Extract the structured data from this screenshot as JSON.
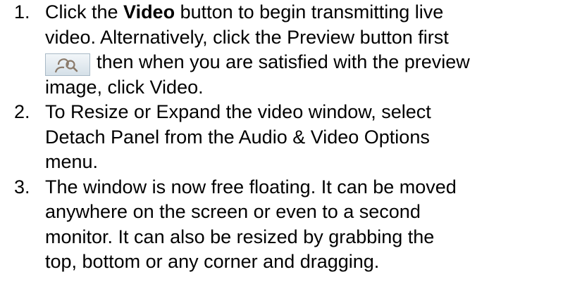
{
  "steps": [
    {
      "number": "1.",
      "line1_prefix": "Click the ",
      "line1_bold": "Video",
      "line1_suffix": " button to begin transmitting live",
      "line2": "video. Alternatively, click the Preview button first",
      "line3_after_icon": "then when you are satisfied with the preview",
      "line4": "image, click Video.",
      "icon": "preview-person-magnifier-icon"
    },
    {
      "number": "2.",
      "lines": [
        "To Resize or Expand the video window, select",
        "Detach Panel from the Audio & Video Options",
        "menu."
      ]
    },
    {
      "number": "3.",
      "lines": [
        "The window is now free floating.  It can be moved",
        "anywhere on the screen or even to a second",
        "monitor.  It can also be resized by grabbing the",
        "top, bottom or any corner and dragging."
      ]
    }
  ],
  "colors": {
    "text": "#000000",
    "icon_stroke": "#8a7a6a",
    "icon_bg": "#dfe7ee"
  }
}
